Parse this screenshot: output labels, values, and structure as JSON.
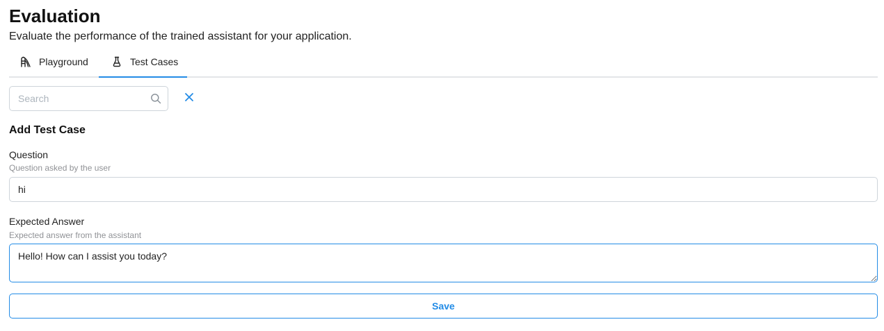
{
  "header": {
    "title": "Evaluation",
    "subtitle": "Evaluate the performance of the trained assistant for your application."
  },
  "tabs": [
    {
      "label": "Playground",
      "icon": "playground-slide-icon",
      "active": false
    },
    {
      "label": "Test Cases",
      "icon": "flask-icon",
      "active": true
    }
  ],
  "search": {
    "placeholder": "Search",
    "value": ""
  },
  "form": {
    "section_title": "Add Test Case",
    "question": {
      "label": "Question",
      "description": "Question asked by the user",
      "value": "hi"
    },
    "expected_answer": {
      "label": "Expected Answer",
      "description": "Expected answer from the assistant",
      "value": "Hello! How can I assist you today?"
    },
    "save_label": "Save"
  },
  "colors": {
    "accent": "#228be6",
    "border": "#ced4da",
    "muted_text": "#909296"
  }
}
